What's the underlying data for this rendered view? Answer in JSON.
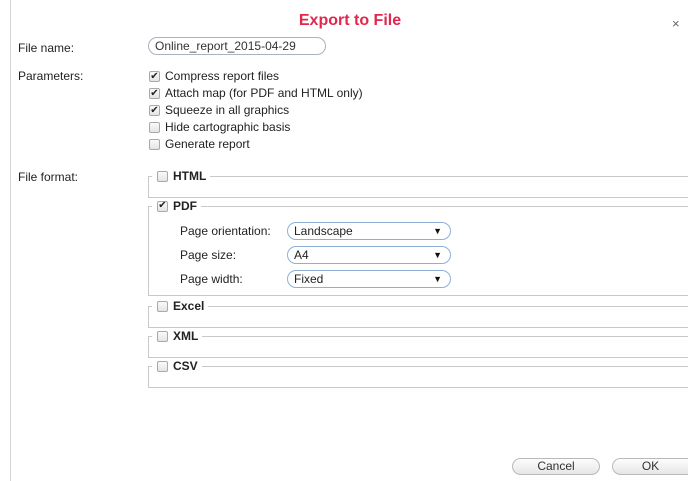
{
  "dialog": {
    "title": "Export to File",
    "close_icon": "×",
    "file_name_label": "File name:",
    "file_name_value": "Online_report_2015-04-29",
    "parameters_label": "Parameters:",
    "file_format_label": "File format:",
    "cancel_label": "Cancel",
    "ok_label": "OK"
  },
  "parameters": [
    {
      "label": "Compress report files",
      "checked": true
    },
    {
      "label": "Attach map (for PDF and HTML only)",
      "checked": true
    },
    {
      "label": "Squeeze in all graphics",
      "checked": true
    },
    {
      "label": "Hide cartographic basis",
      "checked": false
    },
    {
      "label": "Generate report",
      "checked": false
    }
  ],
  "formats": [
    {
      "label": "HTML",
      "checked": false
    },
    {
      "label": "PDF",
      "checked": true
    },
    {
      "label": "Excel",
      "checked": false
    },
    {
      "label": "XML",
      "checked": false
    },
    {
      "label": "CSV",
      "checked": false
    }
  ],
  "pdf_options": {
    "orientation_label": "Page orientation:",
    "orientation_value": "Landscape",
    "size_label": "Page size:",
    "size_value": "A4",
    "width_label": "Page width:",
    "width_value": "Fixed",
    "dropdown_arrow": "▼"
  },
  "check_mark": "✔",
  "colors": {
    "title": "#e2264d",
    "select_border": "#8fb0d6"
  }
}
